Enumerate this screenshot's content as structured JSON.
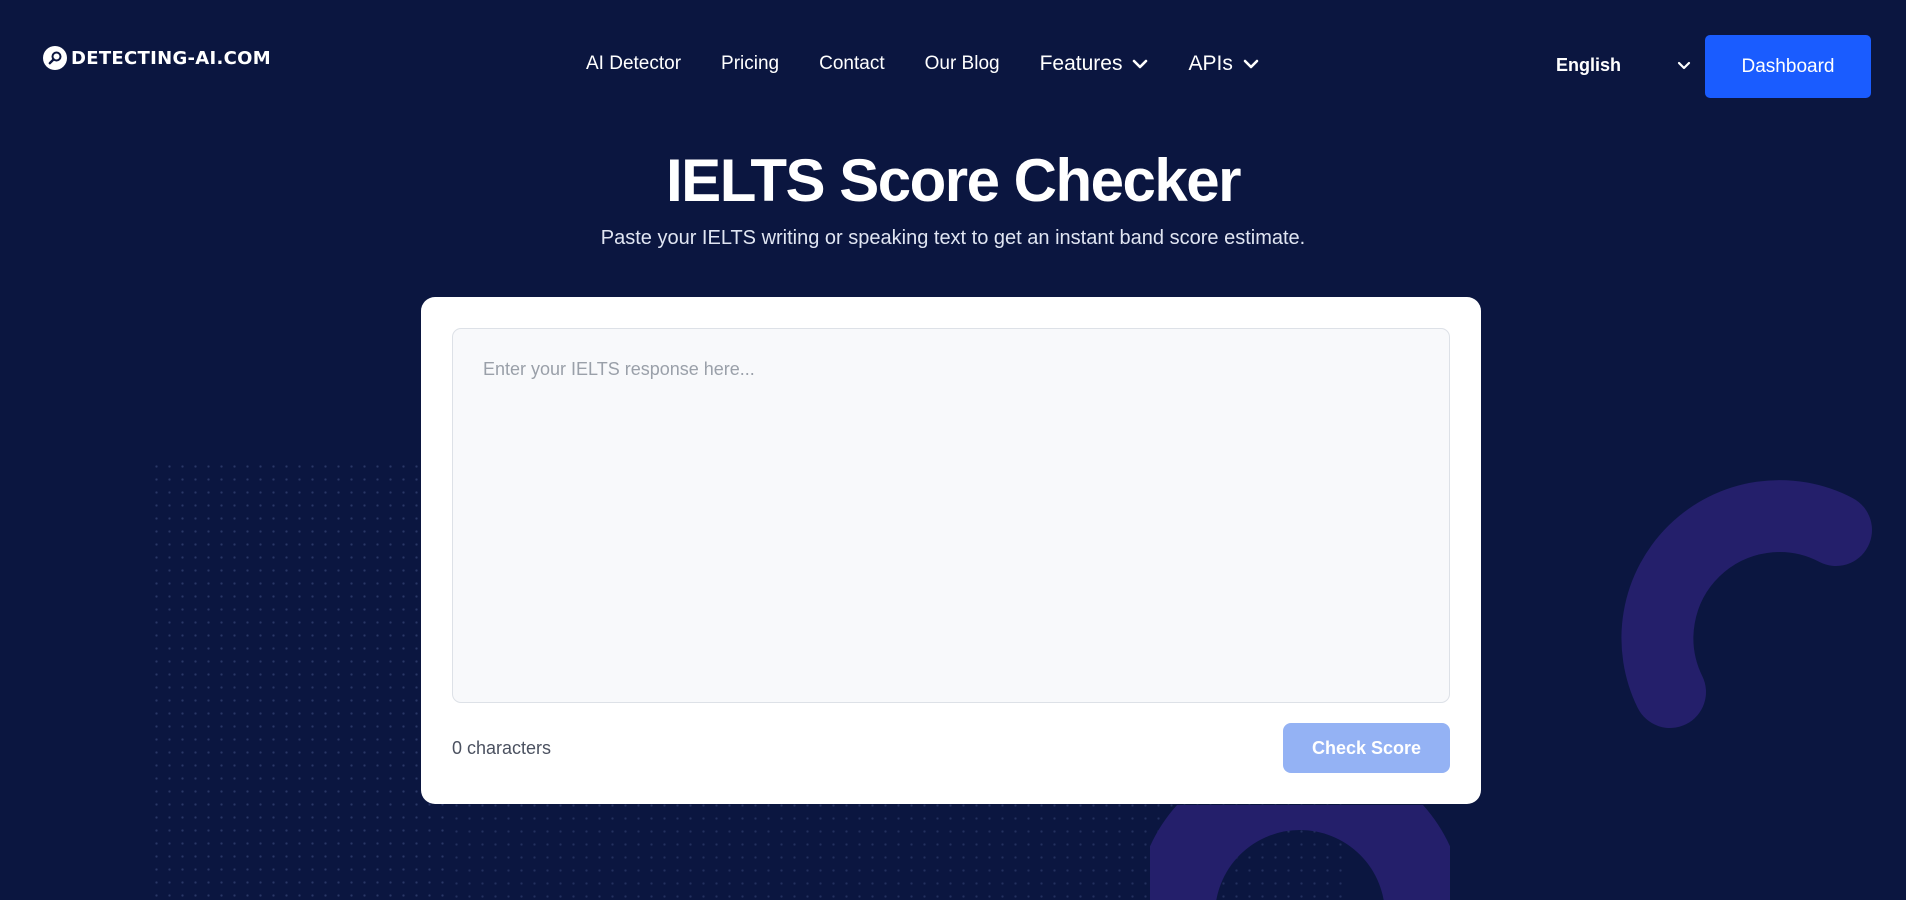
{
  "header": {
    "logo_text": "DETECTING-AI.COM",
    "nav": [
      {
        "label": "AI Detector"
      },
      {
        "label": "Pricing"
      },
      {
        "label": "Contact"
      },
      {
        "label": "Our Blog"
      },
      {
        "label": "Features",
        "dropdown": true
      },
      {
        "label": "APIs",
        "dropdown": true
      }
    ],
    "language": "English",
    "dashboard_label": "Dashboard"
  },
  "hero": {
    "title": "IELTS Score Checker",
    "subtitle": "Paste your IELTS writing or speaking text to get an instant band score estimate."
  },
  "checker": {
    "placeholder": "Enter your IELTS response here...",
    "char_count": "0 characters",
    "button_label": "Check Score"
  },
  "colors": {
    "background": "#0b1640",
    "accent": "#1a5cff",
    "decoration": "#241f6b",
    "disabled_button": "#94b2f4"
  }
}
